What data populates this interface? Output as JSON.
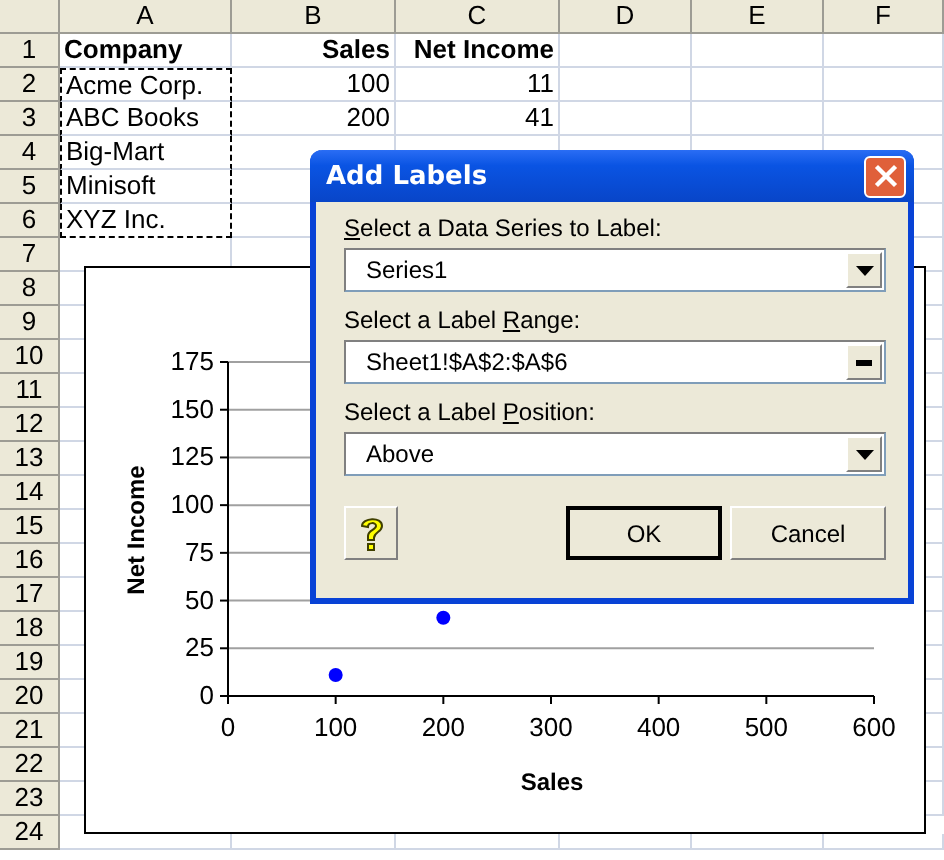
{
  "columns": [
    "A",
    "B",
    "C",
    "D",
    "E",
    "F"
  ],
  "rows": [
    {
      "number": "1",
      "bold": true,
      "in_selection": false,
      "cells": {
        "A": "Company",
        "B": "Sales",
        "C": "Net Income"
      }
    },
    {
      "number": "2",
      "bold": false,
      "in_selection": true,
      "cells": {
        "A": "Acme Corp.",
        "B": "100",
        "C": "11"
      }
    },
    {
      "number": "3",
      "bold": false,
      "in_selection": true,
      "cells": {
        "A": "ABC Books",
        "B": "200",
        "C": "41"
      }
    },
    {
      "number": "4",
      "bold": false,
      "in_selection": true,
      "cells": {
        "A": "Big-Mart"
      }
    },
    {
      "number": "5",
      "bold": false,
      "in_selection": true,
      "cells": {
        "A": "Minisoft"
      }
    },
    {
      "number": "6",
      "bold": false,
      "in_selection": true,
      "cells": {
        "A": "XYZ Inc."
      }
    },
    {
      "number": "7"
    },
    {
      "number": "8"
    },
    {
      "number": "9"
    },
    {
      "number": "10"
    },
    {
      "number": "11"
    },
    {
      "number": "12"
    },
    {
      "number": "13"
    },
    {
      "number": "14"
    },
    {
      "number": "15"
    },
    {
      "number": "16"
    },
    {
      "number": "17"
    },
    {
      "number": "18"
    },
    {
      "number": "19"
    },
    {
      "number": "20"
    },
    {
      "number": "21"
    },
    {
      "number": "22"
    },
    {
      "number": "23"
    },
    {
      "number": "24"
    }
  ],
  "chart": {
    "chart_data": {
      "type": "scatter",
      "xlabel": "Sales",
      "ylabel": "Net Income",
      "x": [
        100,
        200
      ],
      "grid": true,
      "series": [
        {
          "color": "#0000ff",
          "values": [
            11,
            41
          ]
        }
      ],
      "xlim": [
        0,
        600
      ],
      "ylim": [
        0,
        175
      ],
      "xticks": [
        {
          "value": 0,
          "label": "0"
        },
        {
          "value": 100,
          "label": "100"
        },
        {
          "value": 200,
          "label": "200"
        },
        {
          "value": 300,
          "label": "300"
        },
        {
          "value": 400,
          "label": "400"
        },
        {
          "value": 500,
          "label": "500"
        },
        {
          "value": 600,
          "label": "600"
        }
      ],
      "yticks": [
        {
          "value": 0,
          "label": "0"
        },
        {
          "value": 25,
          "label": "25"
        },
        {
          "value": 50,
          "label": "50"
        },
        {
          "value": 75,
          "label": "75"
        },
        {
          "value": 100,
          "label": "100"
        },
        {
          "value": 125,
          "label": "125"
        },
        {
          "value": 150,
          "label": "150"
        },
        {
          "value": 175,
          "label": "175"
        }
      ]
    }
  },
  "dialog": {
    "title": "Add Labels",
    "fields": [
      {
        "kind": "dropdown",
        "label": [
          {
            "text": "S",
            "underlined": true
          },
          {
            "text": "elect a Data Series to Label:",
            "underlined": false
          }
        ],
        "value": "Series1"
      },
      {
        "kind": "range",
        "label": [
          {
            "text": "Select a Label ",
            "underlined": false
          },
          {
            "text": "R",
            "underlined": true
          },
          {
            "text": "ange:",
            "underlined": false
          }
        ],
        "value": "Sheet1!$A$2:$A$6"
      },
      {
        "kind": "dropdown",
        "label": [
          {
            "text": "Select a Label ",
            "underlined": false
          },
          {
            "text": "P",
            "underlined": true
          },
          {
            "text": "osition:",
            "underlined": false
          }
        ],
        "value": "Above"
      }
    ],
    "buttons": [
      {
        "kind": "help"
      },
      {
        "kind": "text",
        "label": "OK",
        "default": true
      },
      {
        "kind": "text",
        "label": "Cancel",
        "default": false
      }
    ]
  }
}
